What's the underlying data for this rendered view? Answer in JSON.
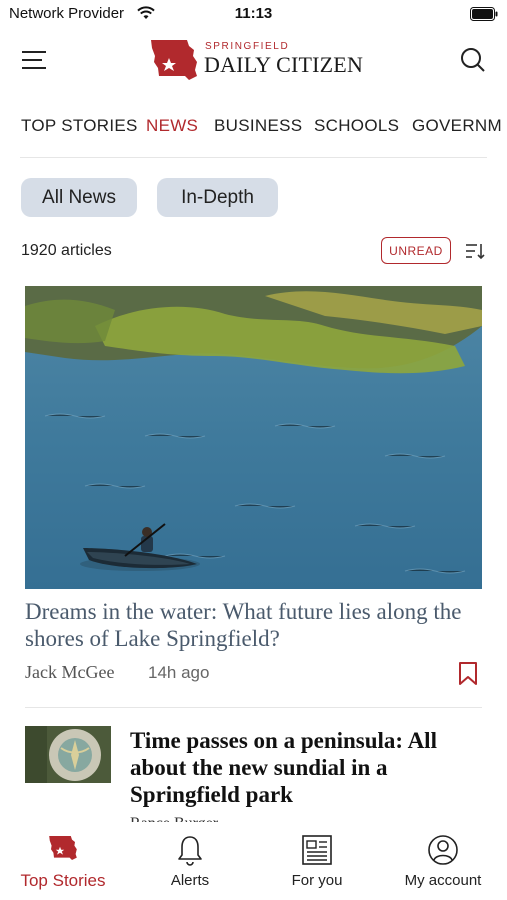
{
  "status": {
    "carrier": "Network Provider",
    "time": "11:13"
  },
  "header": {
    "logo_small": "SPRINGFIELD",
    "logo_main": "DAILY CITIZEN"
  },
  "sections": [
    "TOP STORIES",
    "NEWS",
    "BUSINESS",
    "SCHOOLS",
    "GOVERNM"
  ],
  "active_section": "NEWS",
  "filters": [
    "All News",
    "In-Depth"
  ],
  "list": {
    "count": "1920 articles",
    "unread_label": "UNREAD"
  },
  "articles": [
    {
      "headline": "Dreams in the water: What future lies along the shores of Lake Springfield?",
      "author": "Jack McGee",
      "time": "14h ago"
    },
    {
      "headline": "Time passes on a peninsula: All about the new sundial in a Springfield park",
      "author": "Rance Burger"
    }
  ],
  "tabs": [
    {
      "label": "Top Stories",
      "icon": "state-logo-icon"
    },
    {
      "label": "Alerts",
      "icon": "bell-icon"
    },
    {
      "label": "For you",
      "icon": "newspaper-icon"
    },
    {
      "label": "My account",
      "icon": "account-icon"
    }
  ],
  "colors": {
    "accent": "#b1292d",
    "chip": "#d6dde7",
    "headline_blue": "#4a5a6c"
  }
}
